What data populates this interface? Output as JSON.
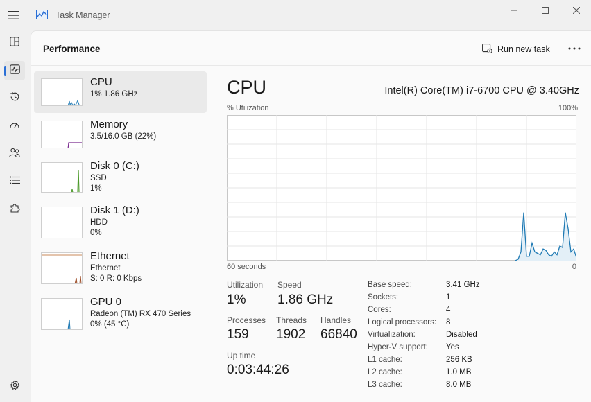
{
  "window": {
    "title": "Task Manager"
  },
  "nav": {
    "items": [
      {
        "name": "processes",
        "icon": "grid-icon"
      },
      {
        "name": "performance",
        "icon": "pulse-icon",
        "active": true
      },
      {
        "name": "app-history",
        "icon": "history-icon"
      },
      {
        "name": "startup-apps",
        "icon": "gauge-icon"
      },
      {
        "name": "users",
        "icon": "users-icon"
      },
      {
        "name": "details",
        "icon": "list-icon"
      },
      {
        "name": "services",
        "icon": "puzzle-icon"
      }
    ],
    "settings_icon": "gear-icon"
  },
  "header": {
    "page_title": "Performance",
    "run_task_label": "Run new task",
    "more_label": "..."
  },
  "devices": [
    {
      "name": "CPU",
      "line1": "1%  1.86 GHz",
      "line2": "",
      "line3": "",
      "color": "#1f7ab4"
    },
    {
      "name": "Memory",
      "line1": "3.5/16.0 GB (22%)",
      "line2": "",
      "line3": "",
      "color": "#7a2a8f"
    },
    {
      "name": "Disk 0 (C:)",
      "line1": "SSD",
      "line2": "1%",
      "line3": "",
      "color": "#4c9a2a"
    },
    {
      "name": "Disk 1 (D:)",
      "line1": "HDD",
      "line2": "0%",
      "line3": "",
      "color": "#4c9a2a"
    },
    {
      "name": "Ethernet",
      "line1": "Ethernet",
      "line2": "S: 0  R: 0 Kbps",
      "line3": "",
      "color": "#a0522d"
    },
    {
      "name": "GPU 0",
      "line1": "Radeon (TM) RX 470 Series",
      "line2": "0% (45 °C)",
      "line3": "",
      "color": "#1f7ab4"
    }
  ],
  "detail": {
    "title": "CPU",
    "model": "Intel(R) Core(TM) i7-6700 CPU @ 3.40GHz",
    "y_label": "% Utilization",
    "y_max_label": "100%",
    "x_label": "60 seconds",
    "x_min_label": "0",
    "graph_color": "#1f7ab4",
    "utilization_series": [
      0,
      0,
      0,
      0,
      0,
      0,
      0,
      0,
      0,
      0,
      0,
      0,
      0,
      0,
      0,
      0,
      0,
      0,
      0,
      0,
      0,
      0,
      0,
      0,
      0,
      0,
      0,
      0,
      0,
      0,
      0,
      0,
      0,
      0,
      0,
      0,
      0,
      0,
      0,
      0,
      0,
      0,
      0,
      0,
      0,
      0,
      0,
      0,
      0,
      0,
      0,
      0,
      0,
      0,
      0,
      0,
      0,
      0,
      0,
      0,
      0,
      0,
      0,
      0,
      0,
      0,
      0,
      0,
      0,
      0,
      0,
      0,
      0,
      0,
      0,
      0,
      0,
      0,
      0,
      0,
      0,
      0,
      0,
      0,
      0,
      0,
      0,
      0,
      0,
      0,
      0,
      0,
      0,
      0,
      0,
      0,
      0,
      0,
      0,
      0,
      0,
      0,
      0,
      0,
      0,
      1,
      6,
      33,
      3,
      3,
      12,
      6,
      5,
      4,
      8,
      7,
      4,
      3,
      6,
      4,
      10,
      9,
      33,
      22,
      6,
      8,
      2
    ],
    "stats": {
      "utilization_label": "Utilization",
      "utilization_value": "1%",
      "speed_label": "Speed",
      "speed_value": "1.86 GHz",
      "processes_label": "Processes",
      "processes_value": "159",
      "threads_label": "Threads",
      "threads_value": "1902",
      "handles_label": "Handles",
      "handles_value": "66840",
      "uptime_label": "Up time",
      "uptime_value": "0:03:44:26"
    },
    "specs": [
      {
        "key": "Base speed:",
        "value": "3.41 GHz"
      },
      {
        "key": "Sockets:",
        "value": "1"
      },
      {
        "key": "Cores:",
        "value": "4"
      },
      {
        "key": "Logical processors:",
        "value": "8"
      },
      {
        "key": "Virtualization:",
        "value": "Disabled"
      },
      {
        "key": "Hyper-V support:",
        "value": "Yes"
      },
      {
        "key": "L1 cache:",
        "value": "256 KB"
      },
      {
        "key": "L2 cache:",
        "value": "1.0 MB"
      },
      {
        "key": "L3 cache:",
        "value": "8.0 MB"
      }
    ]
  }
}
